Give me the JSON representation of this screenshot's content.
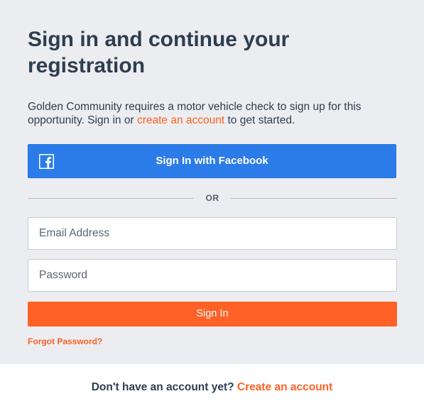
{
  "heading": "Sign in and continue your registration",
  "intro": {
    "text_before": "Golden Community requires a motor vehicle check to sign up for this opportunity. Sign in or ",
    "link": "create an account",
    "text_after": " to get started."
  },
  "facebook": {
    "label": "Sign In with Facebook",
    "icon": "facebook-icon",
    "color": "#2b7ce9"
  },
  "divider": "OR",
  "form": {
    "email_placeholder": "Email Address",
    "password_placeholder": "Password",
    "email_value": "",
    "password_value": ""
  },
  "sign_in_label": "Sign In",
  "forgot_password": "Forgot Password?",
  "footer": {
    "prompt": "Don't have an account yet?",
    "link": "Create an account"
  },
  "colors": {
    "accent": "#ff6126",
    "background": "#ecedf0",
    "text": "#2d3e50"
  }
}
